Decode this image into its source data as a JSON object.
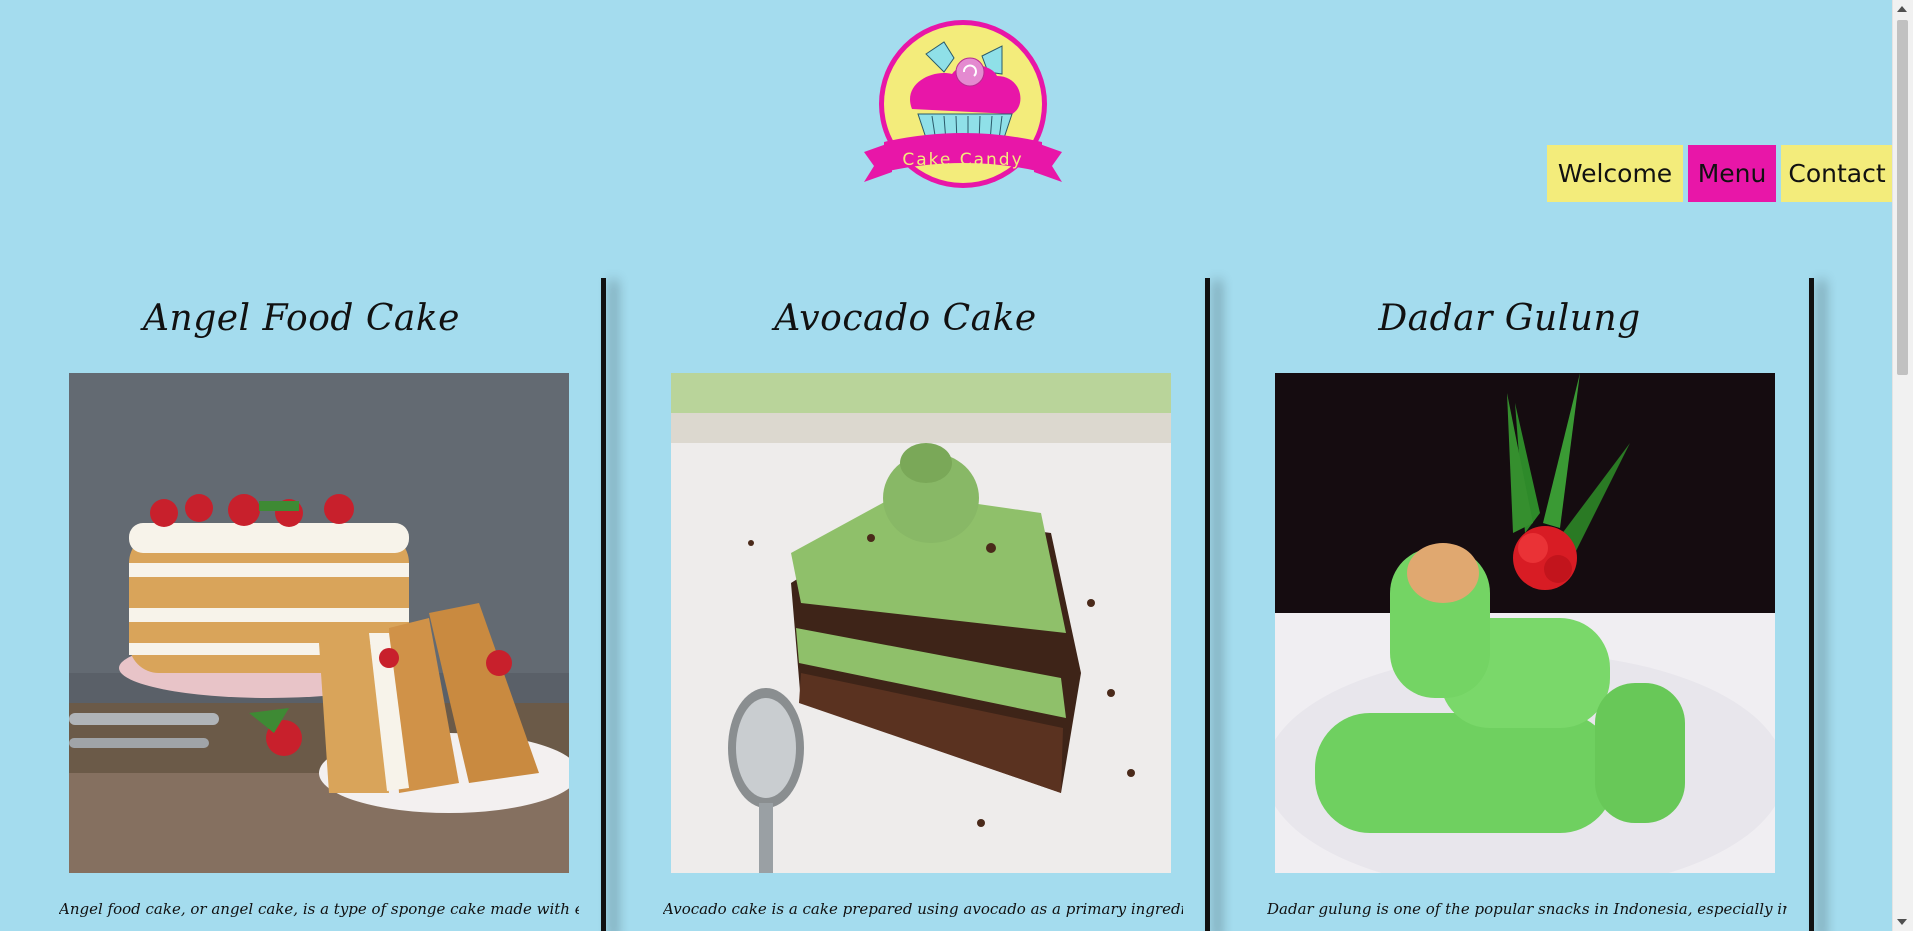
{
  "logo": {
    "text": "Cake Candy",
    "colors": {
      "ring": "#e816a8",
      "fill": "#f3ec7b",
      "frosting": "#e816a8",
      "cup": "#8fe0e8"
    }
  },
  "nav": {
    "items": [
      {
        "label": "Welcome",
        "active": false
      },
      {
        "label": "Menu",
        "active": true
      },
      {
        "label": "Contact",
        "active": false
      }
    ]
  },
  "cards": [
    {
      "title": "Angel Food Cake",
      "image_icon": "angel-food-cake-photo",
      "text": "Angel food cake, or angel cake, is a type of sponge cake made with egg"
    },
    {
      "title": "Avocado Cake",
      "image_icon": "avocado-cake-photo",
      "text": "Avocado cake is a cake prepared using avocado as a primary ingredient,"
    },
    {
      "title": "Dadar Gulung",
      "image_icon": "dadar-gulung-photo",
      "text": "Dadar gulung is one of the popular snacks in Indonesia, especially in Java."
    }
  ],
  "theme": {
    "background": "#a4dcee",
    "nav_bg": "#f3ec7b",
    "nav_active_bg": "#e816a8"
  }
}
